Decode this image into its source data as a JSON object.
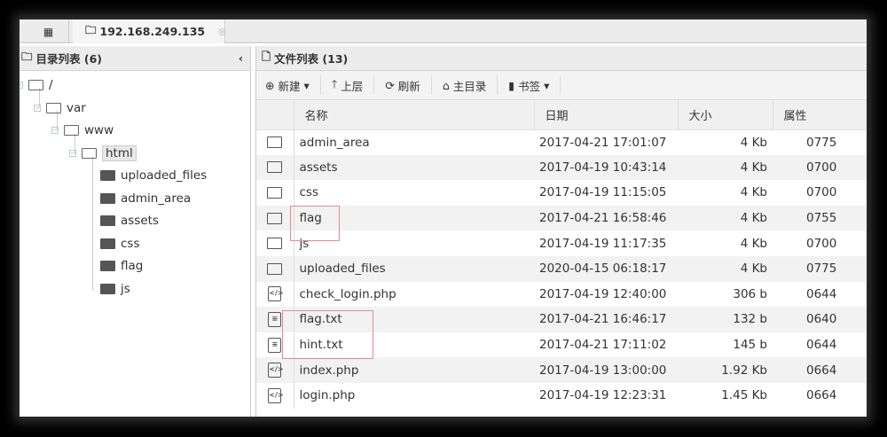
{
  "tab": {
    "title": "192.168.249.135"
  },
  "left": {
    "title": "目录列表 (6)",
    "tree": {
      "root": "/",
      "var": "var",
      "www": "www",
      "html": "html",
      "children": [
        "uploaded_files",
        "admin_area",
        "assets",
        "css",
        "flag",
        "js"
      ]
    }
  },
  "right": {
    "title": "文件列表 (13)",
    "toolbar": {
      "new": "新建",
      "up": "上层",
      "refresh": "刷新",
      "home": "主目录",
      "bookmark": "书签"
    },
    "columns": [
      "名称",
      "日期",
      "大小",
      "属性"
    ],
    "rows": [
      {
        "type": "folder",
        "name": "admin_area",
        "date": "2017-04-21 17:01:07",
        "size": "4 Kb",
        "perm": "0775"
      },
      {
        "type": "folder",
        "name": "assets",
        "date": "2017-04-19 10:43:14",
        "size": "4 Kb",
        "perm": "0700"
      },
      {
        "type": "folder",
        "name": "css",
        "date": "2017-04-19 11:15:05",
        "size": "4 Kb",
        "perm": "0700"
      },
      {
        "type": "folder",
        "name": "flag",
        "date": "2017-04-21 16:58:46",
        "size": "4 Kb",
        "perm": "0755"
      },
      {
        "type": "folder",
        "name": "js",
        "date": "2017-04-19 11:17:35",
        "size": "4 Kb",
        "perm": "0700"
      },
      {
        "type": "folder",
        "name": "uploaded_files",
        "date": "2020-04-15 06:18:17",
        "size": "4 Kb",
        "perm": "0775"
      },
      {
        "type": "code",
        "name": "check_login.php",
        "date": "2017-04-19 12:40:00",
        "size": "306 b",
        "perm": "0644"
      },
      {
        "type": "text",
        "name": "flag.txt",
        "date": "2017-04-21 16:46:17",
        "size": "132 b",
        "perm": "0640"
      },
      {
        "type": "text",
        "name": "hint.txt",
        "date": "2017-04-21 17:11:02",
        "size": "145 b",
        "perm": "0644"
      },
      {
        "type": "code",
        "name": "index.php",
        "date": "2017-04-19 13:00:00",
        "size": "1.92 Kb",
        "perm": "0664"
      },
      {
        "type": "code",
        "name": "login.php",
        "date": "2017-04-19 12:23:31",
        "size": "1.45 Kb",
        "perm": "0664"
      }
    ]
  },
  "colors": {
    "highlight": "#e88888"
  }
}
